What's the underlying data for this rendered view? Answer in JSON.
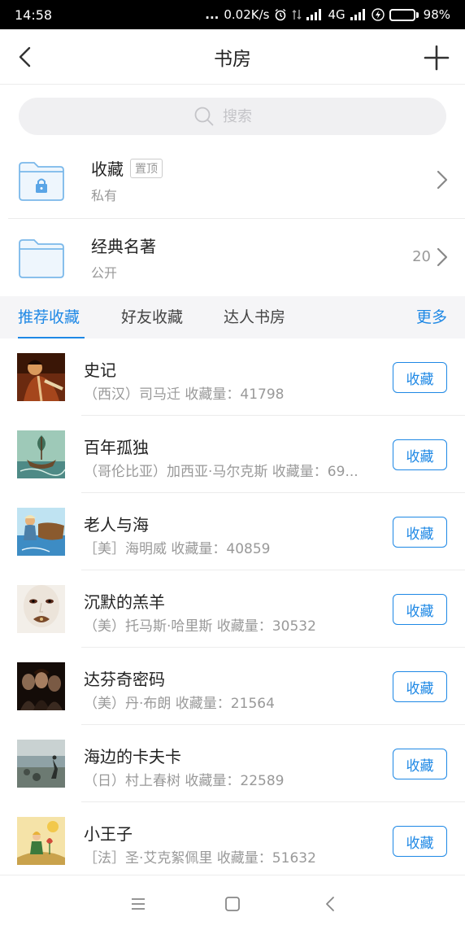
{
  "status_bar": {
    "time": "14:58",
    "dots": "...",
    "speed": "0.02K/s",
    "network": "4G",
    "battery": "98%",
    "battery_level": 0.98,
    "battery_color": "#4cd964"
  },
  "navbar": {
    "title": "书房",
    "back_icon": "chevron-left-icon",
    "add_icon": "plus-icon"
  },
  "search": {
    "placeholder": "搜索",
    "icon": "search-icon"
  },
  "folders": [
    {
      "name": "收藏",
      "badge": "置顶",
      "visibility": "私有",
      "count": "",
      "icon": "locked-folder-icon"
    },
    {
      "name": "经典名著",
      "badge": "",
      "visibility": "公开",
      "count": "20",
      "icon": "folder-icon"
    }
  ],
  "tabs": {
    "items": [
      "推荐收藏",
      "好友收藏",
      "达人书房"
    ],
    "active_index": 0,
    "more": "更多",
    "accent_color": "#1e88e5"
  },
  "books": [
    {
      "title": "史记",
      "meta": "（西汉）司马迁 收藏量：41798",
      "button": "收藏"
    },
    {
      "title": "百年孤独",
      "meta": "（哥伦比亚）加西亚·马尔克斯 收藏量：69...",
      "button": "收藏"
    },
    {
      "title": "老人与海",
      "meta": "［美］海明威 收藏量：40859",
      "button": "收藏"
    },
    {
      "title": "沉默的羔羊",
      "meta": "（美）托马斯·哈里斯 收藏量：30532",
      "button": "收藏"
    },
    {
      "title": "达芬奇密码",
      "meta": "（美）丹·布朗 收藏量：21564",
      "button": "收藏"
    },
    {
      "title": "海边的卡夫卡",
      "meta": "（日）村上春树 收藏量：22589",
      "button": "收藏"
    },
    {
      "title": "小王子",
      "meta": "［法］圣·艾克絮佩里 收藏量：51632",
      "button": "收藏"
    }
  ],
  "system_nav": {
    "icons": [
      "menu-icon",
      "home-square-icon",
      "back-triangle-icon"
    ]
  }
}
